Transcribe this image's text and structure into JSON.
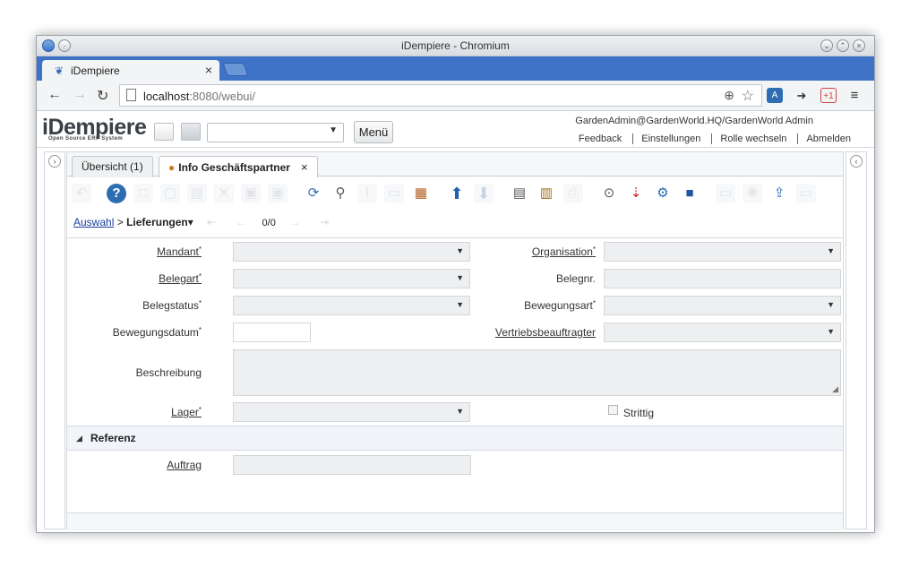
{
  "window": {
    "title": "iDempiere - Chromium"
  },
  "browser": {
    "tab_label": "iDempiere",
    "tab_close": "×",
    "url_host": "localhost",
    "url_rest": ":8080/webui/"
  },
  "app": {
    "logo": "iDempiere",
    "logo_sub": "Open Source ERP System",
    "menu_label": "Menü",
    "user": "GardenAdmin@GardenWorld.HQ/GardenWorld Admin",
    "links": [
      "Feedback",
      "Einstellungen",
      "Rolle wechseln",
      "Abmelden"
    ]
  },
  "window_tabs": [
    {
      "label": "Übersicht (1)"
    },
    {
      "label": "Info Geschäftspartner",
      "close": "×"
    }
  ],
  "breadcrumb": {
    "root": "Auswahl",
    "separator": ">",
    "current": "Lieferungen",
    "record_count": "0/0"
  },
  "form": {
    "mandant": {
      "label": "Mandant",
      "value": ""
    },
    "organisation": {
      "label": "Organisation",
      "value": ""
    },
    "belegart": {
      "label": "Belegart",
      "value": ""
    },
    "belegnr": {
      "label": "Belegnr.",
      "value": ""
    },
    "belegstatus": {
      "label": "Belegstatus",
      "value": ""
    },
    "bewegungsart": {
      "label": "Bewegungsart",
      "value": ""
    },
    "bewegungsdatum": {
      "label": "Bewegungsdatum",
      "value": ""
    },
    "vertriebsbeauftragter": {
      "label": "Vertriebsbeauftragter",
      "value": ""
    },
    "beschreibung": {
      "label": "Beschreibung",
      "value": ""
    },
    "lager": {
      "label": "Lager",
      "value": ""
    },
    "strittig": {
      "label": "Strittig",
      "checked": false
    }
  },
  "referenz": {
    "section_label": "Referenz",
    "auftrag": {
      "label": "Auftrag",
      "value": ""
    }
  },
  "required_mark": "*"
}
